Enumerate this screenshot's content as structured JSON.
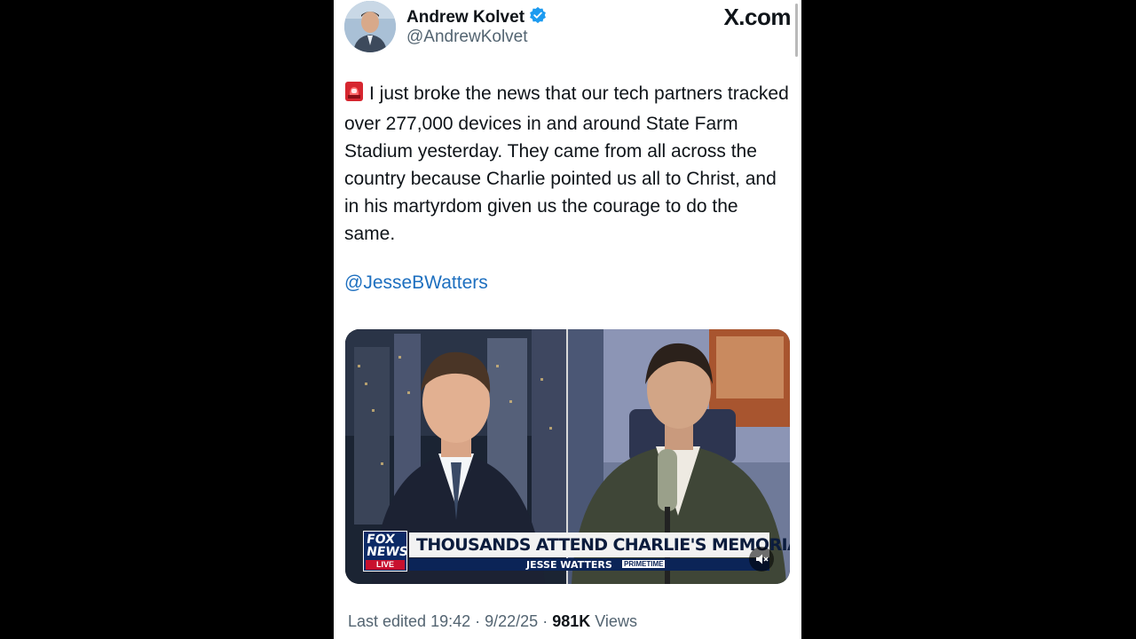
{
  "author": {
    "display_name": "Andrew Kolvet",
    "handle": "@AndrewKolvet",
    "verified_icon": "verified-badge-icon"
  },
  "brand": {
    "label": "X.com",
    "icon": "x-logo-icon"
  },
  "tweet": {
    "emoji": "rotating-light-icon",
    "text": "I just broke the news that our tech partners tracked over 277,000 devices in and around State Farm Stadium yesterday. They came from all across the country because Charlie pointed us all to Christ, and in his martyrdom given us the courage to do the same.",
    "mention": "@JesseBWatters"
  },
  "media": {
    "type": "video",
    "chyron": {
      "network_line1": "FOX",
      "network_line2": "NEWS",
      "live": "LIVE",
      "headline": "THOUSANDS ATTEND CHARLIE'S MEMORIAL",
      "show": "JESSE WATTERS",
      "show_sub": "PRIMETIME"
    },
    "mute_icon": "volume-muted-icon"
  },
  "footer": {
    "edited": "Last edited 19:42 · 9/22/25",
    "separator": "·",
    "views_count": "981K",
    "views_label": "Views"
  },
  "colors": {
    "link": "#1d6fbf",
    "verified": "#1d9bf0",
    "text": "#0f1419",
    "muted": "#536471"
  }
}
